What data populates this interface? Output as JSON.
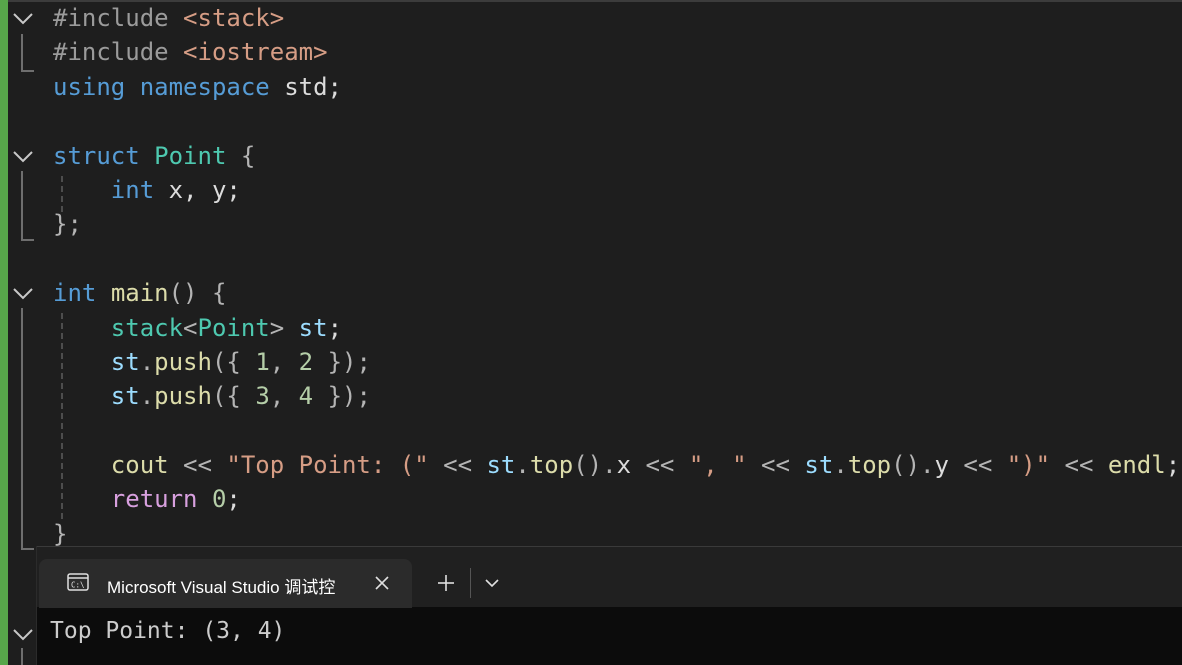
{
  "editor": {
    "lines": [
      {
        "kind": "pp",
        "text": "#include ",
        "arg": "<stack>"
      },
      {
        "kind": "pp",
        "text": "#include ",
        "arg": "<iostream>"
      },
      {
        "kind": "using",
        "kw1": "using",
        "kw2": "namespace",
        "rest": " std;"
      },
      {
        "kind": "blank"
      },
      {
        "kind": "struct",
        "kw": "struct",
        "name": "Point",
        "rest": " {"
      },
      {
        "kind": "decl",
        "kw": "int",
        "rest": " x, y;"
      },
      {
        "kind": "close",
        "text": "};"
      },
      {
        "kind": "blank"
      },
      {
        "kind": "main",
        "kw": "int",
        "fn": "main",
        "rest": "() {"
      },
      {
        "kind": "stackdecl",
        "type": "stack",
        "lt": "<",
        "param": "Point",
        "gt": ">",
        "var": "st",
        "end": ";"
      },
      {
        "kind": "push",
        "var": "st",
        "fn": "push",
        "a": "1",
        "b": "2"
      },
      {
        "kind": "push",
        "var": "st",
        "fn": "push",
        "a": "3",
        "b": "4"
      },
      {
        "kind": "blank"
      },
      {
        "kind": "cout",
        "cout": "cout",
        "s1": "\"Top Point: (\"",
        "v1": "st",
        "f1": "top",
        "m1": "x",
        "s2": "\", \"",
        "v2": "st",
        "f2": "top",
        "m2": "y",
        "s3": "\")\"",
        "endl": "endl"
      },
      {
        "kind": "ret",
        "kw": "return",
        "num": "0"
      },
      {
        "kind": "close",
        "text": "}"
      }
    ]
  },
  "terminal": {
    "tab_title": "Microsoft Visual Studio 调试控",
    "icon": "console-app-icon",
    "output": "Top Point: (3, 4)"
  },
  "colors": {
    "keyword": "#569cd6",
    "type": "#4ec9b0",
    "function": "#dcdcaa",
    "string": "#d69d85",
    "number": "#b5cea8",
    "variable": "#9cdcfe",
    "control": "#d8a0df",
    "preprocessor": "#9b9b9b",
    "change_bar": "#57a64a"
  }
}
